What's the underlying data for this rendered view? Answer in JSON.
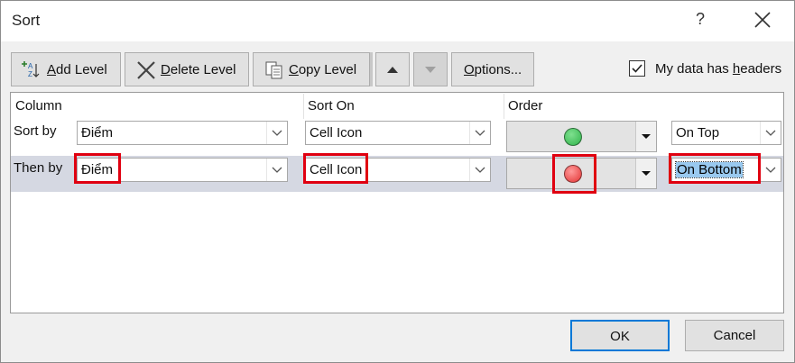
{
  "window": {
    "title": "Sort",
    "help_label": "?"
  },
  "toolbar": {
    "add_level": {
      "prefix": "",
      "accel": "A",
      "rest": "dd Level"
    },
    "delete_level": {
      "accel": "D",
      "rest": "elete Level"
    },
    "copy_level": {
      "accel": "C",
      "rest": "opy Level"
    },
    "options": {
      "accel": "O",
      "rest": "ptions..."
    }
  },
  "headers_checkbox": {
    "checked": true,
    "label_pre": "My data has ",
    "accel": "h",
    "label_post": "eaders"
  },
  "grid": {
    "columns": [
      "Column",
      "Sort On",
      "Order"
    ],
    "rows": [
      {
        "label": "Sort by",
        "column": "Điểm",
        "sort_on": "Cell Icon",
        "icon_color": "#2fb34a",
        "order": "On Top"
      },
      {
        "label": "Then by",
        "column": "Điểm",
        "sort_on": "Cell Icon",
        "icon_color": "#ee3b3b",
        "order": "On Bottom"
      }
    ]
  },
  "buttons": {
    "ok": "OK",
    "cancel": "Cancel"
  },
  "colors": {
    "highlight_box": "#e00010",
    "selected_row": "#d5d8e2",
    "ok_border": "#0078d7"
  }
}
